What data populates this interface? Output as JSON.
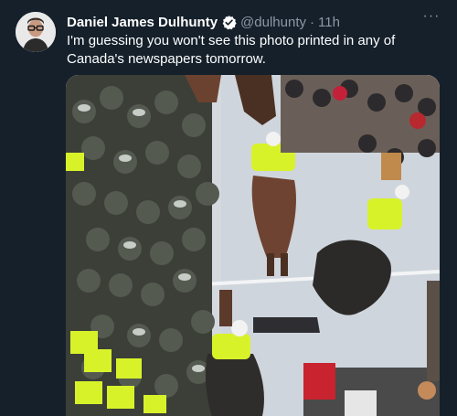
{
  "tweet": {
    "author_name": "Daniel James Dulhunty",
    "handle": "@dulhunty",
    "separator": "·",
    "timestamp": "11h",
    "text": "I'm guessing you won't see this photo printed in any of Canada's newspapers tomorrow.",
    "more_label": "···"
  },
  "icons": {
    "avatar": "avatar-image",
    "verified": "verified-badge-icon",
    "more": "more-options-icon"
  },
  "colors": {
    "background": "#15202b",
    "primary_text": "#ffffff",
    "secondary_text": "#8b98a5",
    "verified_blue": "#1d9bf0",
    "hi_vis_yellow": "#d8f22a"
  }
}
